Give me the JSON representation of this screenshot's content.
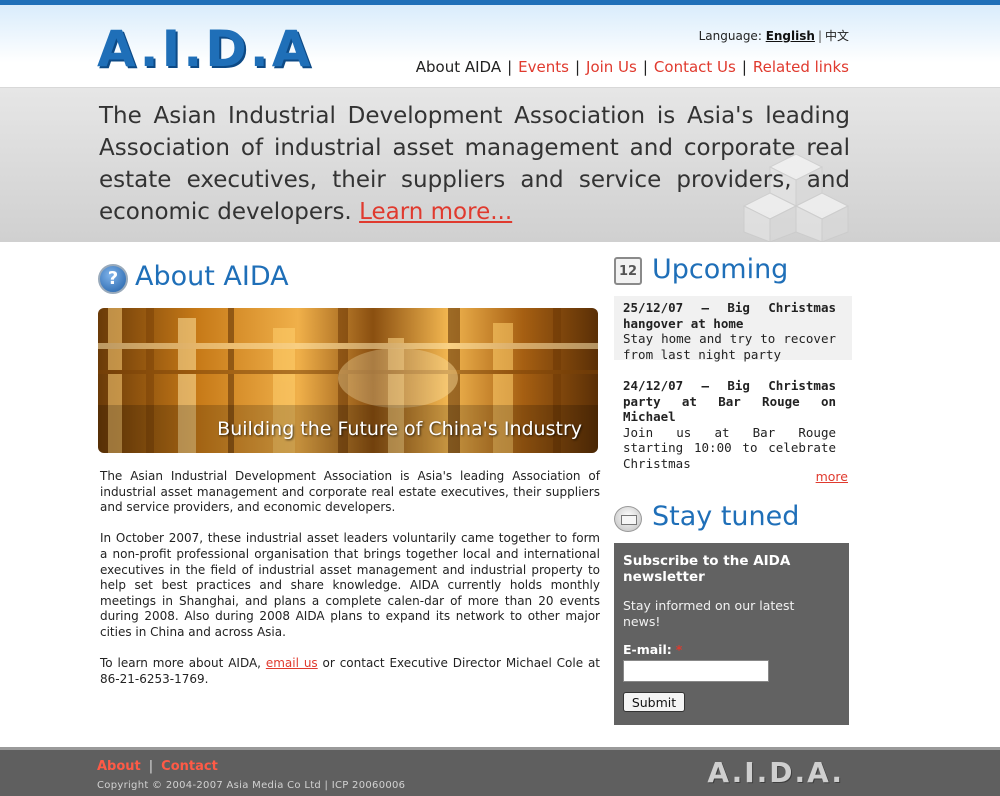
{
  "header": {
    "logo_text": "A.I.D.A",
    "language_label": "Language:",
    "language_english": "English",
    "language_chinese": "中文",
    "nav": [
      {
        "label": "About AIDA"
      },
      {
        "label": "Events"
      },
      {
        "label": "Join Us"
      },
      {
        "label": "Contact Us"
      },
      {
        "label": "Related links"
      }
    ]
  },
  "hero": {
    "text": "The Asian Industrial Development Association is Asia's leading Association of industrial asset management and corporate real estate executives, their suppliers and service providers, and economic developers.",
    "learn_more": "Learn more..."
  },
  "about": {
    "title": "About AIDA",
    "banner_caption": "Building the Future of China's Industry",
    "para1": "The Asian Industrial Development Association is Asia's leading Association of industrial asset management and corporate real estate executives, their suppliers and service providers, and economic developers.",
    "para2": "In October 2007, these industrial asset leaders voluntarily came together to form a non-profit professional organisation that brings together local and international executives in the field of industrial asset management and industrial property to help set best practices and share knowledge. AIDA currently holds monthly meetings in Shanghai, and plans a complete calen-dar of more than 20 events during 2008.  Also during 2008 AIDA plans to expand its network to other major cities in China and across Asia.",
    "para3_before": "To learn more about AIDA, ",
    "para3_link": "email us",
    "para3_after": " or contact Executive Director Michael Cole at 86-21-6253-1769."
  },
  "upcoming": {
    "title": "Upcoming",
    "calendar_icon_text": "12",
    "events": [
      {
        "title": "25/12/07 – Big Christmas hangover at home",
        "desc": "Stay home and try to recover from last night party"
      },
      {
        "title": "24/12/07 – Big Christmas party at Bar Rouge on Michael",
        "desc": "Join us at Bar Rouge starting 10:00 to celebrate Christmas"
      }
    ],
    "more": "more"
  },
  "stay_tuned": {
    "title": "Stay tuned",
    "newsletter_title": "Subscribe to the AIDA newsletter",
    "newsletter_desc": "Stay informed on our latest news!",
    "email_label": "E-mail:",
    "required_mark": "*",
    "email_value": "",
    "submit_label": "Submit"
  },
  "footer": {
    "links": [
      {
        "label": "About"
      },
      {
        "label": "Contact"
      }
    ],
    "copyright": "Copyright © 2004-2007 Asia Media Co Ltd | ICP 20060006",
    "logo_text": "A.I.D.A."
  },
  "colors": {
    "brand_blue": "#1f6fb8",
    "link_red": "#e03a2e",
    "newsletter_bg": "#626262",
    "footer_bg": "#5f5f5f"
  },
  "icons": {
    "about": "question-icon",
    "upcoming": "calendar-icon",
    "stay_tuned": "envelope-icon"
  }
}
